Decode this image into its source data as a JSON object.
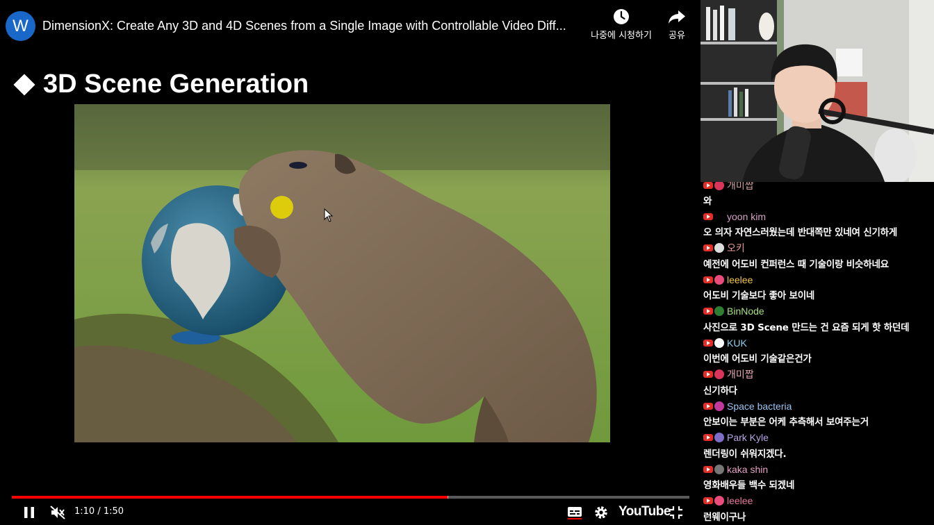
{
  "player": {
    "channel_initial": "W",
    "video_title": "DimensionX: Create Any 3D and 4D Scenes from a Single Image with Controllable Video Diff...",
    "watch_later_label": "나중에 시청하기",
    "share_label": "공유",
    "slide_title": "3D Scene Generation",
    "current_time": "1:10",
    "duration": "1:50",
    "time_display": "1:10 / 1:50",
    "progress_fraction": 0.643,
    "buffered_fraction": 0.644,
    "logo_text": "YouTube",
    "icons": [
      "clock-icon",
      "share-arrow-icon",
      "pause-icon",
      "mute-icon",
      "subtitles-icon",
      "gear-icon",
      "exit-fullscreen-icon"
    ]
  },
  "chat": {
    "partial_top": {
      "author": "개미짭",
      "text": "와",
      "author_color": "#d0a0a0"
    },
    "messages": [
      {
        "author": "yoon kim",
        "text": "오 의자 자연스러웠는데 반대쪽만 있네여 신기하게",
        "author_color": "#d8a0c8",
        "avatar_color": "#000000"
      },
      {
        "author": "오키",
        "text": "예전에 어도비 컨퍼런스 때 기술이랑 비슷하네요",
        "author_color": "#e79a9a",
        "avatar_color": "#dddddd"
      },
      {
        "author": "leelee",
        "text": "어도비 기술보다 좋아 보이네",
        "author_color": "#f2c84b",
        "avatar_color": "#e94c7a"
      },
      {
        "author": "BinNode",
        "text": "사진으로 3D Scene 만드는 건 요즘 되게 핫 하던데",
        "author_color": "#a7e07a",
        "avatar_color": "#2e7d32"
      },
      {
        "author": "KUK",
        "text": "이번에 어도비 기술같은건가",
        "author_color": "#8fd3f0",
        "avatar_color": "#ffffff"
      },
      {
        "author": "개미짭",
        "text": "신기하다",
        "author_color": "#e4a6b4",
        "avatar_color": "#d9345b"
      },
      {
        "author": "Space bacteria",
        "text": "안보이는 부분은 어케 추측해서 보여주는거",
        "author_color": "#9ec4f2",
        "avatar_color": "#c0399b"
      },
      {
        "author": "Park Kyle",
        "text": "렌더링이 쉬워지겠다.",
        "author_color": "#b7a6e8",
        "avatar_color": "#7e6cc7"
      },
      {
        "author": "kaka shin",
        "text": "영화배우들 백수 되겠네",
        "author_color": "#e7a0c6",
        "avatar_color": "#777777"
      },
      {
        "author": "leelee",
        "text": "런웨이구나",
        "author_color": "#e77aa0",
        "avatar_color": "#e94c7a"
      }
    ]
  }
}
